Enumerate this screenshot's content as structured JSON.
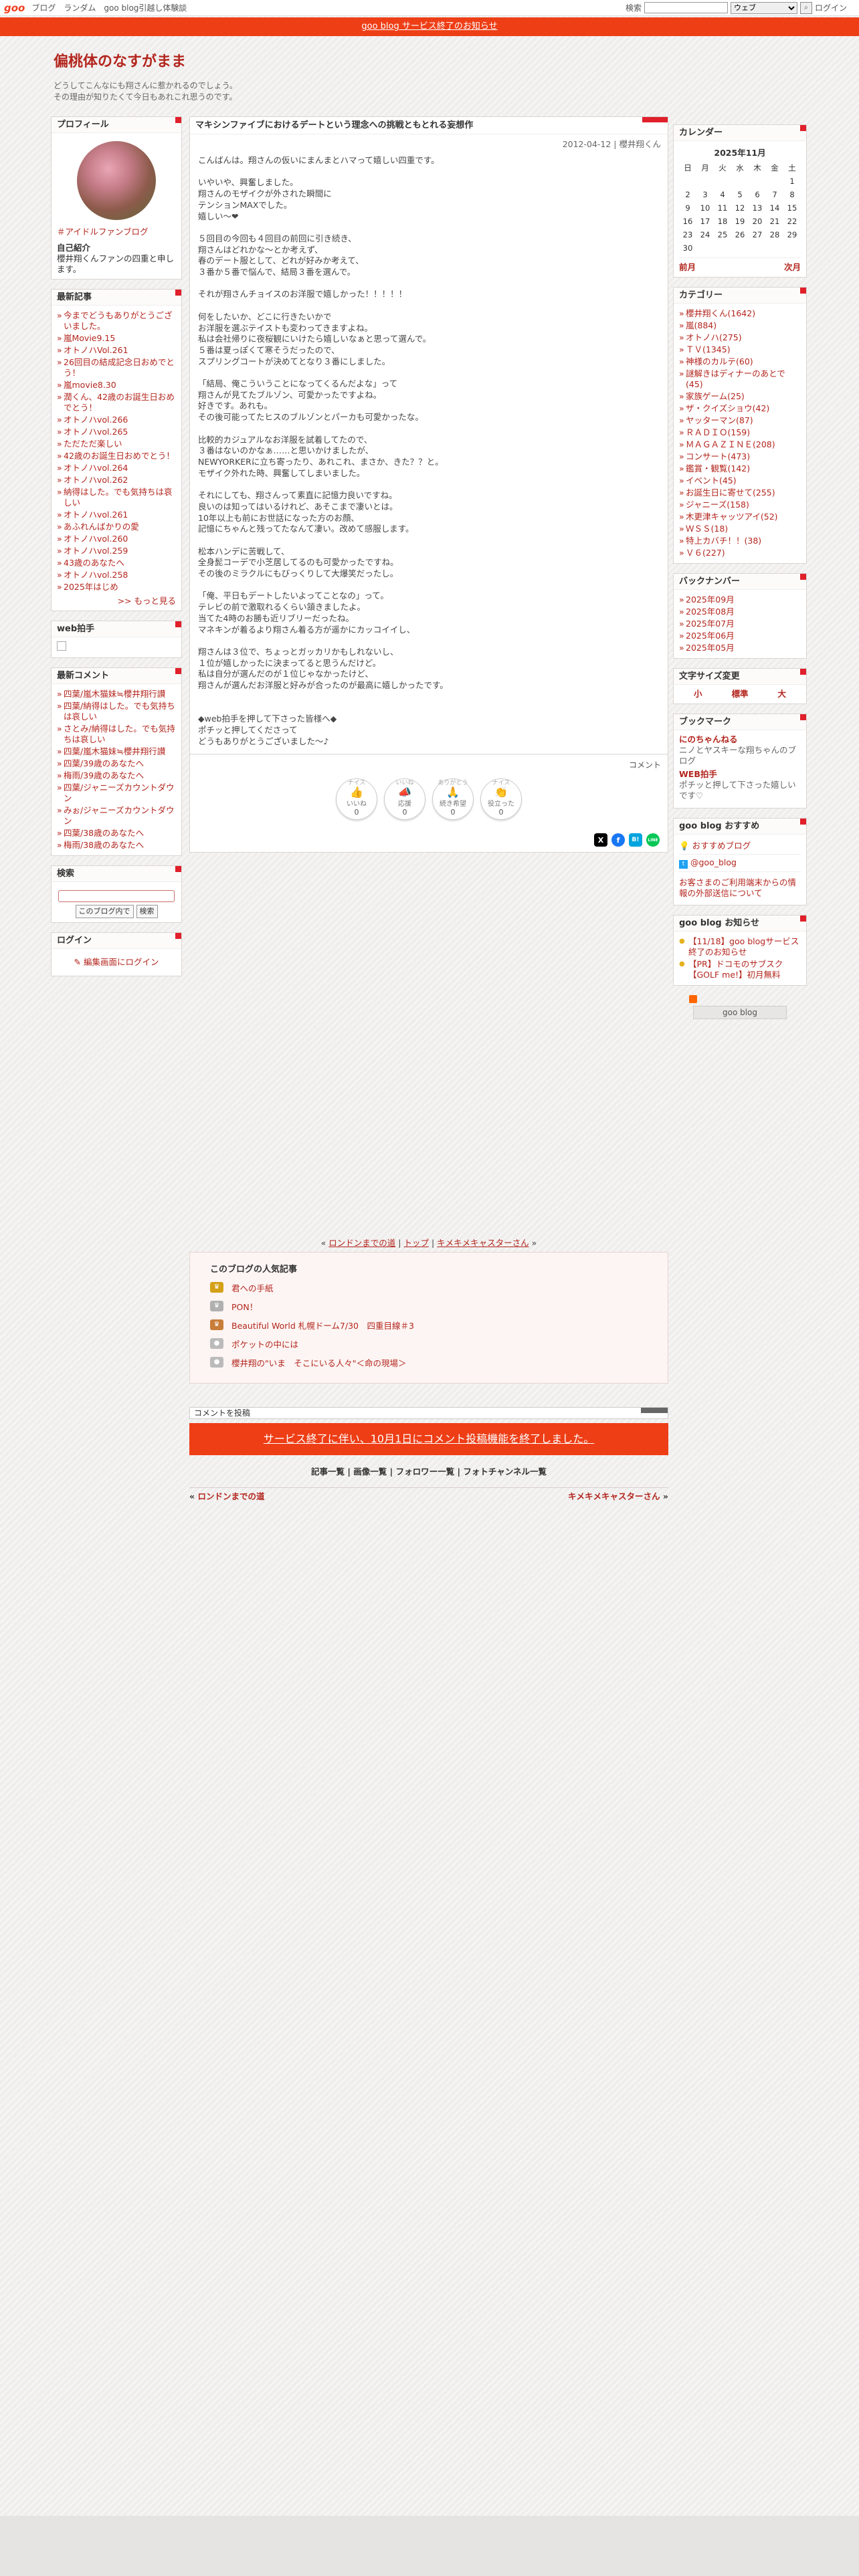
{
  "topbar": {
    "logo": "goo",
    "links": [
      "ブログ",
      "ランダム",
      "goo blog引越し体験談"
    ],
    "search_label": "検索",
    "search_value": "",
    "search_scope": "ウェブ",
    "login": "ログイン"
  },
  "notice": "goo blog サービス終了のお知らせ",
  "blog": {
    "title": "偏桃体のなすがまま",
    "desc1": "どうしてこんなにも翔さんに惹かれるのでしょう。",
    "desc2": "その理由が知りたくて今日もあれこれ思うのです。"
  },
  "profile": {
    "heading": "プロフィール",
    "link": "＃アイドルファンブログ",
    "intro_title": "自己紹介",
    "intro": "櫻井翔くんファンの四重と申します。"
  },
  "recent": {
    "heading": "最新記事",
    "items": [
      "今までどうもありがとうございました。",
      "嵐Movie9.15",
      "オトノハVol.261",
      "26回目の結成記念日おめでとう！",
      "嵐movie8.30",
      "潤くん、42歳のお誕生日おめでとう！",
      "オトノハvol.266",
      "オトノハvol.265",
      "ただただ楽しい",
      "42歳のお誕生日おめでとう！",
      "オトノハvol.264",
      "オトノハvol.262",
      "納得はした。でも気持ちは哀しい",
      "オトノハvol.261",
      "あふれんばかりの愛",
      "オトノハvol.260",
      "オトノハvol.259",
      "43歳のあなたへ",
      "オトノハvol.258",
      "2025年はじめ"
    ],
    "more": ">> もっと見る"
  },
  "webclap": {
    "heading": "web拍手"
  },
  "comments": {
    "heading": "最新コメント",
    "items": [
      "四葉/嵐木猫妹≒櫻井翔行讃",
      "四葉/納得はした。でも気持ちは哀しい",
      "さとみ/納得はした。でも気持ちは哀しい",
      "四葉/嵐木猫妹≒櫻井翔行讃",
      "四葉/39歳のあなたへ",
      "梅雨/39歳のあなたへ",
      "四葉/ジャニーズカウントダウン",
      "みぉ/ジャニーズカウントダウン",
      "四葉/38歳のあなたへ",
      "梅雨/38歳のあなたへ"
    ]
  },
  "search": {
    "heading": "検索",
    "scope": "このブログ内で",
    "button": "検索"
  },
  "login": {
    "heading": "ログイン",
    "edit": "編集画面にログイン"
  },
  "article": {
    "title": "マキシンファイブにおけるデートという理念への挑戦ともとれる妄想作",
    "date": "2012-04-12 | 櫻井翔くん",
    "body": "こんばんは。翔さんの仮いにまんまとハマって嬉しい四重です。\n\nいやいや、興奮しました。\n翔さんのモザイクが外された瞬間に\nテンションMAXでした。\n嬉しい～❤\n\n５回目の今回も４回目の前回に引き続き、\n翔さんはどれかな～とか考えず、\n春のデート服として、どれが好みか考えて、\n３番か５番で悩んで、結局３番を選んで。\n\nそれが翔さんチョイスのお洋服で嬉しかった！！！！！\n\n何をしたいか、どこに行きたいかで\nお洋服を選ぶテイストも変わってきますよね。\n私は会社帰りに夜桜観にいけたら嬉しいなぁと思って選んで。\n５番は夏っぽくて寒そうだったので、\nスプリングコートが決めてとなり３番にしました。\n\n「結局、俺こういうことになってくるんだよな」って\n翔さんが見てたブルゾン、可愛かったですよね。\n好きです。あれも。\nその後可能ってたヒスのブルゾンとパーカも可愛かったな。\n\n比較的カジュアルなお洋服を試着してたので、\n３番はないのかなぁ……と思いかけましたが、\nNEWYORKERに立ち寄ったり、あれこれ、まさか、きた？？と。\nモザイク外れた時、興奮してしまいました。\n\nそれにしても、翔さんって素直に記憶力良いですね。\n良いのは知ってはいるけれど、あそこまで凄いとは。\n10年以上も前にお世話になった方のお顔、\n記憶にちゃんと残ってたなんて凄い。改めて感服します。\n\n松本ハンデに苦戦して、\n全身髭コーデで小芝居してるのも可愛かったですね。\nその後のミラクルにもびっくりして大爆笑だったし。\n\n「俺、平日もデートしたいよってことなの」って。\nテレビの前で激取れるくらい頷きましたよ。\n当てた4時のお勝も近リブリーだったね。\nマネキンが着るより翔さん着る方が遥かにカッコイイし、\n\n翔さんは３位で、ちょっとガッカリかもしれないし、\n１位が嬉しかったに決まってると思うんだけど。\n私は自分が選んだのが１位じゃなかったけど、\n翔さんが選んだお洋服と好みが合ったのが最高に嬉しかったです。\n\n\n◆web拍手を押して下さった皆様へ◆\nポチッと押してくださって\nどうもありがとうございました～♪",
    "comment": "コメント",
    "reactions": [
      {
        "top": "ナイス",
        "label": "いいね",
        "count": "0"
      },
      {
        "top": "いいね",
        "label": "応援",
        "count": "0"
      },
      {
        "top": "ありがとう",
        "label": "続き希望",
        "count": "0"
      },
      {
        "top": "ナイス",
        "label": "役立った",
        "count": "0"
      }
    ],
    "share": [
      "X",
      "f",
      "B!",
      "LINE"
    ]
  },
  "calendar": {
    "heading": "カレンダー",
    "month": "2025年11月",
    "days": [
      "日",
      "月",
      "火",
      "水",
      "木",
      "金",
      "土"
    ],
    "weeks": [
      [
        "",
        "",
        "",
        "",
        "",
        "",
        "1"
      ],
      [
        "2",
        "3",
        "4",
        "5",
        "6",
        "7",
        "8"
      ],
      [
        "9",
        "10",
        "11",
        "12",
        "13",
        "14",
        "15"
      ],
      [
        "16",
        "17",
        "18",
        "19",
        "20",
        "21",
        "22"
      ],
      [
        "23",
        "24",
        "25",
        "26",
        "27",
        "28",
        "29"
      ],
      [
        "30",
        "",
        "",
        "",
        "",
        "",
        ""
      ]
    ],
    "prev": "前月",
    "next": "次月"
  },
  "categories": {
    "heading": "カテゴリー",
    "items": [
      "櫻井翔くん(1642)",
      "嵐(884)",
      "オトノハ(275)",
      "ＴＶ(1345)",
      "神様のカルテ(60)",
      "謎解きはディナーのあとで(45)",
      "家族ゲーム(25)",
      "ザ・クイズショウ(42)",
      "ヤッターマン(87)",
      "ＲＡＤＩＯ(159)",
      "ＭＡＧＡＺＩＮＥ(208)",
      "コンサート(473)",
      "鑑賞・観覧(142)",
      "イベント(45)",
      "お誕生日に寄せて(255)",
      "ジャニーズ(158)",
      "木更津キャッツアイ(52)",
      "ＷＳＳ(18)",
      "特上カバチ！！(38)",
      "Ｖ６(227)"
    ]
  },
  "backnumber": {
    "heading": "バックナンバー",
    "items": [
      "2025年09月",
      "2025年08月",
      "2025年07月",
      "2025年06月",
      "2025年05月"
    ]
  },
  "fontsize": {
    "heading": "文字サイズ変更",
    "small": "小",
    "mid": "標準",
    "large": "大"
  },
  "bookmark": {
    "heading": "ブックマーク",
    "items": [
      {
        "t": "にのちゃんねる",
        "d": "ニノとヤスキーな翔ちゃんのブログ"
      },
      {
        "t": "WEB拍手",
        "d": "ポチッと押して下さった嬉しいです♡"
      }
    ]
  },
  "recommend": {
    "heading": "goo blog おすすめ",
    "items": [
      "おすすめブログ",
      "@goo_blog",
      "お客さまのご利用端末からの情報の外部送信について"
    ]
  },
  "news": {
    "heading": "goo blog お知らせ",
    "items": [
      "【11/18】goo blogサービス終了のお知らせ",
      "【PR】ドコモのサブスク【GOLF me!】初月無料"
    ]
  },
  "sidefoot": "goo blog",
  "nav1": {
    "prev": "ロンドンまでの道",
    "top": "トップ",
    "next": "キメキメキャスターさん"
  },
  "popular": {
    "heading": "このブログの人気記事",
    "items": [
      "君への手紙",
      "PON！",
      "Beautiful World 札幌ドーム7/30　四重目線＃3",
      "ポケットの中には",
      "櫻井翔の\"いま　そこにいる人々\"＜命の現場＞"
    ]
  },
  "commentpost": "コメントを投稿",
  "commentend": "サービス終了に伴い、10月1日にコメント投稿機能を終了しました。",
  "links": [
    "記事一覧",
    "画像一覧",
    "フォロワー一覧",
    "フォトチャンネル一覧"
  ],
  "bnav": {
    "prev": "ロンドンまでの道",
    "next": "キメキメキャスターさん"
  }
}
